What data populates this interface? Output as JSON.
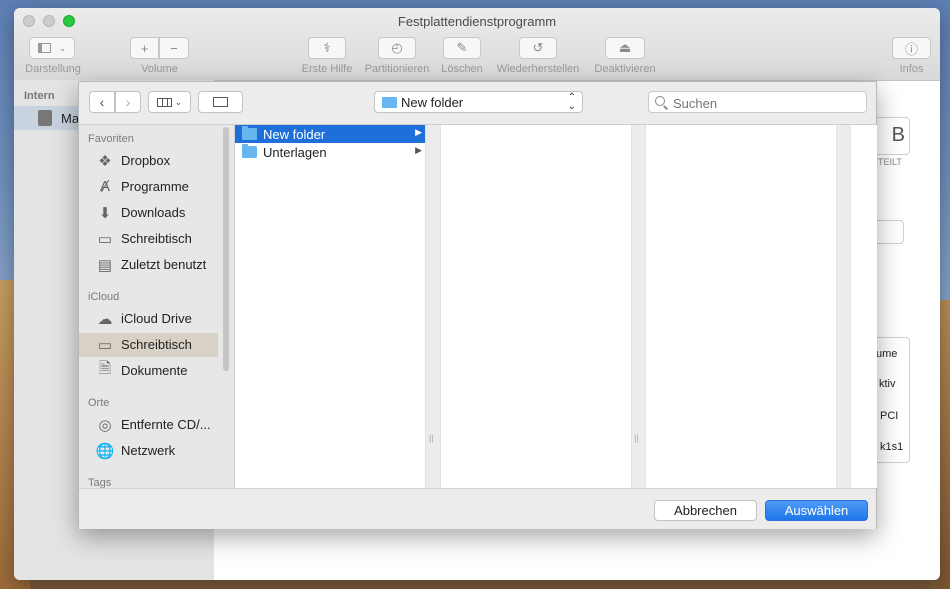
{
  "window": {
    "title": "Festplattendienstprogramm",
    "toolbar": [
      {
        "label": "Darstellung",
        "icon": "sidebar-toggle-icon"
      },
      {
        "label": "Volume",
        "icon": "plus-minus-icon"
      },
      {
        "label": "Erste Hilfe",
        "icon": "stethoscope-icon"
      },
      {
        "label": "Partitionieren",
        "icon": "pie-icon"
      },
      {
        "label": "Löschen",
        "icon": "erase-icon"
      },
      {
        "label": "Wiederherstellen",
        "icon": "restore-icon"
      },
      {
        "label": "Deaktivieren",
        "icon": "eject-icon"
      },
      {
        "label": "Infos",
        "icon": "info-icon"
      }
    ],
    "sidebar": {
      "section": "Intern",
      "selected_item": "Ma"
    },
    "background_fragments": [
      "B",
      "ETEILT",
      "ume",
      "ktiv",
      "PCI",
      "k1s1"
    ]
  },
  "dialog": {
    "path_popup": "New folder",
    "search_placeholder": "Suchen",
    "sidebar": {
      "sections": [
        {
          "title": "Favoriten",
          "items": [
            {
              "label": "Dropbox",
              "icon": "dropbox-icon"
            },
            {
              "label": "Programme",
              "icon": "applications-icon"
            },
            {
              "label": "Downloads",
              "icon": "downloads-icon"
            },
            {
              "label": "Schreibtisch",
              "icon": "desktop-icon"
            },
            {
              "label": "Zuletzt benutzt",
              "icon": "recents-icon"
            }
          ]
        },
        {
          "title": "iCloud",
          "items": [
            {
              "label": "iCloud Drive",
              "icon": "cloud-icon"
            },
            {
              "label": "Schreibtisch",
              "icon": "desktop-icon",
              "selected": true
            },
            {
              "label": "Dokumente",
              "icon": "documents-icon"
            }
          ]
        },
        {
          "title": "Orte",
          "items": [
            {
              "label": "Entfernte CD/...",
              "icon": "disc-icon"
            },
            {
              "label": "Netzwerk",
              "icon": "network-icon"
            }
          ]
        },
        {
          "title": "Tags",
          "items": []
        }
      ]
    },
    "column1": [
      {
        "name": "New folder",
        "selected": true
      },
      {
        "name": "Unterlagen",
        "selected": false
      }
    ],
    "buttons": {
      "cancel": "Abbrechen",
      "confirm": "Auswählen"
    },
    "colors": {
      "selection": "#1e6fd9",
      "folder": "#67b6f2",
      "primary_button": "#2a80ee"
    }
  }
}
